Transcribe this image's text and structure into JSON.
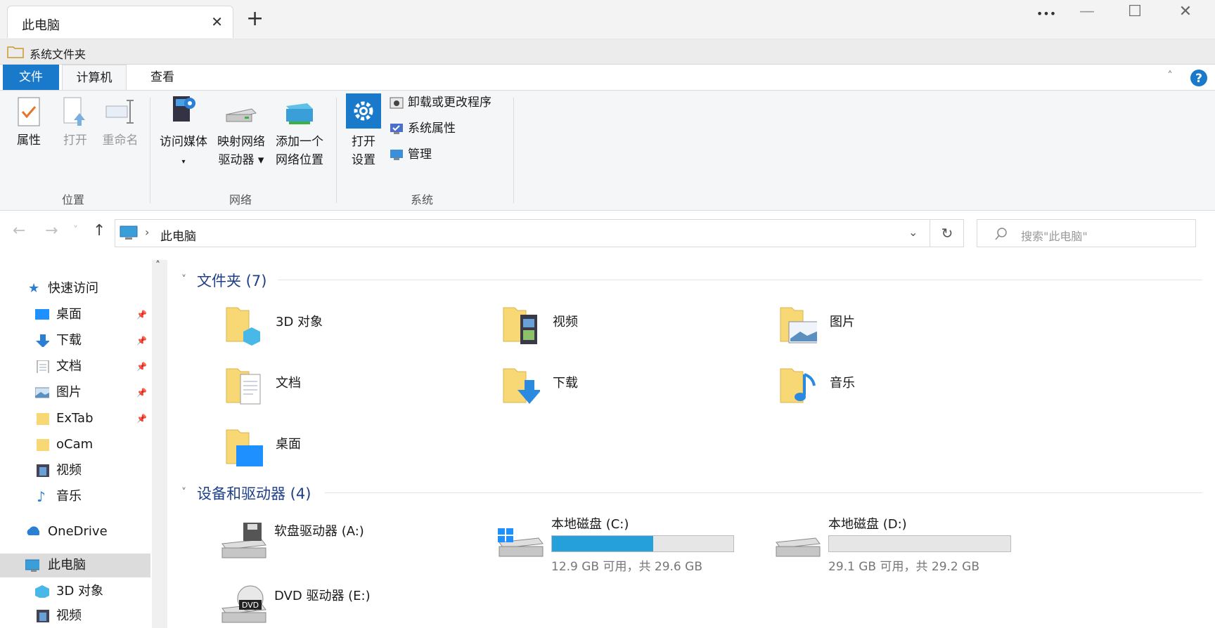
{
  "window": {
    "tab_title": "此电脑",
    "tab_close": "✕",
    "new_tab": "+",
    "more": "•••",
    "minimize": "—",
    "maximize": "☐",
    "close": "✕"
  },
  "path_strip": {
    "label": "系统文件夹"
  },
  "ribbon_tabs": {
    "file": "文件",
    "computer": "计算机",
    "view": "查看"
  },
  "ribbon": {
    "properties": "属性",
    "open": "打开",
    "rename": "重命名",
    "group_location": "位置",
    "access_media_1": "访问媒体",
    "map_drive_1": "映射网络",
    "map_drive_2": "驱动器 ▾",
    "add_location_1": "添加一个",
    "add_location_2": "网络位置",
    "group_network": "网络",
    "open_settings_1": "打开",
    "open_settings_2": "设置",
    "uninstall": "卸载或更改程序",
    "system_properties": "系统属性",
    "manage": "管理",
    "group_system": "系统"
  },
  "nav": {
    "back": "←",
    "forward": "→",
    "recent": "˅",
    "up": "↑",
    "address": "此电脑",
    "address_sep": "›",
    "refresh": "↻",
    "search_placeholder": "搜索\"此电脑\""
  },
  "sidebar": {
    "items": [
      {
        "label": "快速访问"
      },
      {
        "label": "桌面"
      },
      {
        "label": "下载"
      },
      {
        "label": "文档"
      },
      {
        "label": "图片"
      },
      {
        "label": "ExTab"
      },
      {
        "label": "oCam"
      },
      {
        "label": "视频"
      },
      {
        "label": "音乐"
      },
      {
        "label": "OneDrive"
      },
      {
        "label": "此电脑"
      },
      {
        "label": "3D 对象"
      },
      {
        "label": "视频"
      }
    ]
  },
  "folders_group": {
    "title": "文件夹 (7)"
  },
  "folders": [
    {
      "label": "3D 对象"
    },
    {
      "label": "视频"
    },
    {
      "label": "图片"
    },
    {
      "label": "文档"
    },
    {
      "label": "下载"
    },
    {
      "label": "音乐"
    },
    {
      "label": "桌面"
    }
  ],
  "devices_group": {
    "title": "设备和驱动器 (4)"
  },
  "drives": [
    {
      "label": "软盘驱动器 (A:)"
    },
    {
      "label": "本地磁盘 (C:)",
      "size": "12.9 GB 可用，共 29.6 GB",
      "used_fraction": 0.56
    },
    {
      "label": "本地磁盘 (D:)",
      "size": "29.1 GB 可用，共 29.2 GB",
      "used_fraction": 0.0
    },
    {
      "label": "DVD 驱动器 (E:)"
    }
  ],
  "colors": {
    "accent": "#1979ca",
    "folder": "#f8d775",
    "bar_fill": "#26a0da"
  }
}
